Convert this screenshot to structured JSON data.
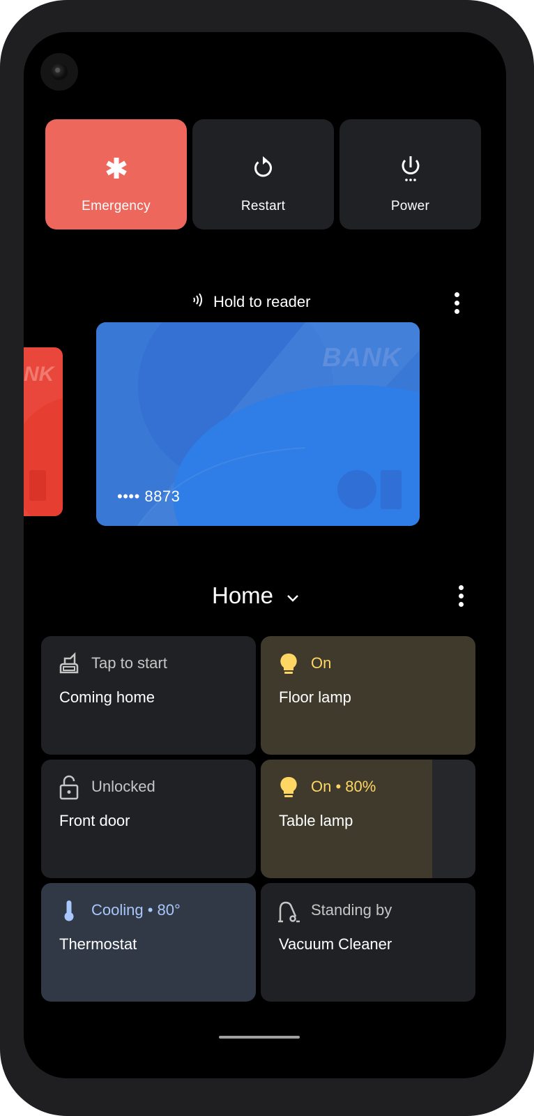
{
  "power_menu": {
    "emergency_label": "Emergency",
    "restart_label": "Restart",
    "power_label": "Power",
    "emergency_color": "#ee675c"
  },
  "wallet": {
    "hold_label": "Hold to reader",
    "card_bank_text": "BANK",
    "card_number": "•••• 8873",
    "card_color": "#3a78d6",
    "side_card_color": "#e9473b"
  },
  "home": {
    "title": "Home",
    "tiles": [
      {
        "name": "Coming home",
        "status": "Tap to start",
        "icon": "routine-icon"
      },
      {
        "name": "Floor lamp",
        "status": "On",
        "icon": "lightbulb-icon"
      },
      {
        "name": "Front door",
        "status": "Unlocked",
        "icon": "unlocked-icon"
      },
      {
        "name": "Table lamp",
        "status": "On • 80%",
        "icon": "lightbulb-icon",
        "brightness": 0.8
      },
      {
        "name": "Thermostat",
        "status": "Cooling • 80°",
        "icon": "thermometer-icon"
      },
      {
        "name": "Vacuum Cleaner",
        "status": "Standing by",
        "icon": "vacuum-icon"
      }
    ]
  }
}
